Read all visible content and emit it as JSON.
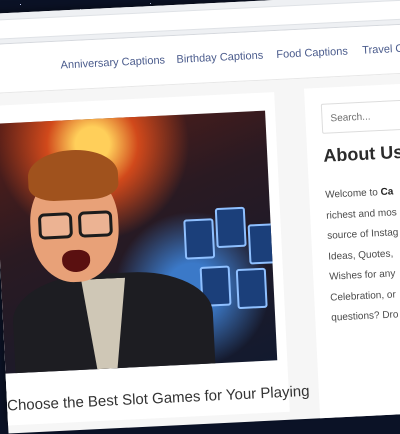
{
  "nav": {
    "items": [
      "Anniversary Captions",
      "Birthday Captions",
      "Food Captions",
      "Travel Captions"
    ]
  },
  "post": {
    "title": "Choose the Best Slot Games for Your Playing"
  },
  "sidebar": {
    "search_placeholder": "Search...",
    "about_heading": "About Us",
    "about_lines": [
      {
        "text": "Welcome to ",
        "bold": "Ca"
      },
      {
        "text": "richest and mos"
      },
      {
        "text": "source of Instag"
      },
      {
        "text": "Ideas, Quotes, "
      },
      {
        "text": "Wishes for any"
      },
      {
        "text": "Celebration, or"
      },
      {
        "text": "questions? Dro"
      }
    ]
  },
  "colors": {
    "nav_link": "#4a5b8c",
    "background_space": "#0b1226"
  }
}
